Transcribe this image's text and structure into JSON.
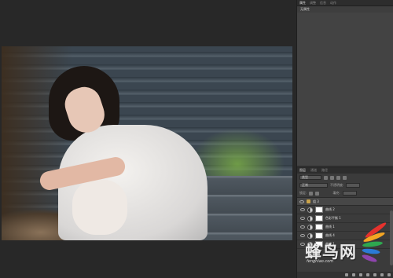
{
  "properties_panel": {
    "tabs": [
      "属性",
      "调整",
      "信息",
      "动作"
    ],
    "title": "无属性"
  },
  "layers_panel": {
    "tabs": [
      "图层",
      "通道",
      "路径"
    ],
    "kind_label": "类型",
    "blend_mode": "正常",
    "opacity_label": "不透明度:",
    "lock_label": "锁定:",
    "fill_label": "填充:",
    "group_name": "组 3",
    "layers": [
      {
        "name": "曲线 2"
      },
      {
        "name": "色彩平衡 1"
      },
      {
        "name": "曲线 1"
      },
      {
        "name": "曲线 4"
      },
      {
        "name": "曲线 1"
      }
    ]
  },
  "watermark": {
    "text": "蜂鸟网",
    "url": "fengniao.com",
    "colors": [
      "#e5322d",
      "#f5a623",
      "#2ea84f",
      "#2b7bd6",
      "#8e44ad"
    ]
  }
}
